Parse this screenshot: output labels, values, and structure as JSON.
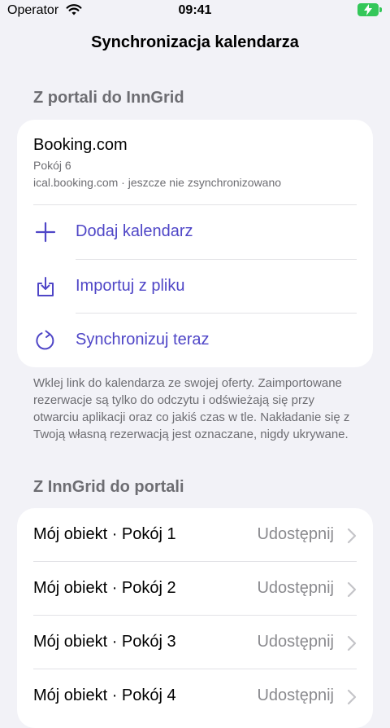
{
  "status_bar": {
    "carrier": "Operator",
    "time": "09:41"
  },
  "nav": {
    "title": "Synchronizacja kalendarza"
  },
  "import_section": {
    "header": "Z portali do InnGrid",
    "feed": {
      "name": "Booking.com",
      "room": "Pokój 6",
      "meta": "ical.booking.com · jeszcze nie zsynchronizowano"
    },
    "actions": [
      {
        "label": "Dodaj kalendarz",
        "icon": "plus-icon"
      },
      {
        "label": "Importuj z pliku",
        "icon": "import-icon"
      },
      {
        "label": "Synchronizuj teraz",
        "icon": "sync-icon"
      }
    ],
    "footer": "Wklej link do kalendarza ze swojej oferty. Zaimportowane rezerwacje są tylko do odczytu i odświeżają się przy otwarciu aplikacji oraz co jakiś czas w tle. Nakładanie się z Twoją własną rezerwacją jest oznaczane, nigdy ukrywane."
  },
  "export_section": {
    "header": "Z InnGrid do portali",
    "rows": [
      {
        "title": "Mój obiekt · Pokój 1",
        "action": "Udostępnij"
      },
      {
        "title": "Mój obiekt · Pokój 2",
        "action": "Udostępnij"
      },
      {
        "title": "Mój obiekt · Pokój 3",
        "action": "Udostępnij"
      },
      {
        "title": "Mój obiekt · Pokój 4",
        "action": "Udostępnij"
      }
    ]
  },
  "colors": {
    "accent": "#4f46c7",
    "background": "#f2f2f7",
    "battery": "#34c759"
  }
}
